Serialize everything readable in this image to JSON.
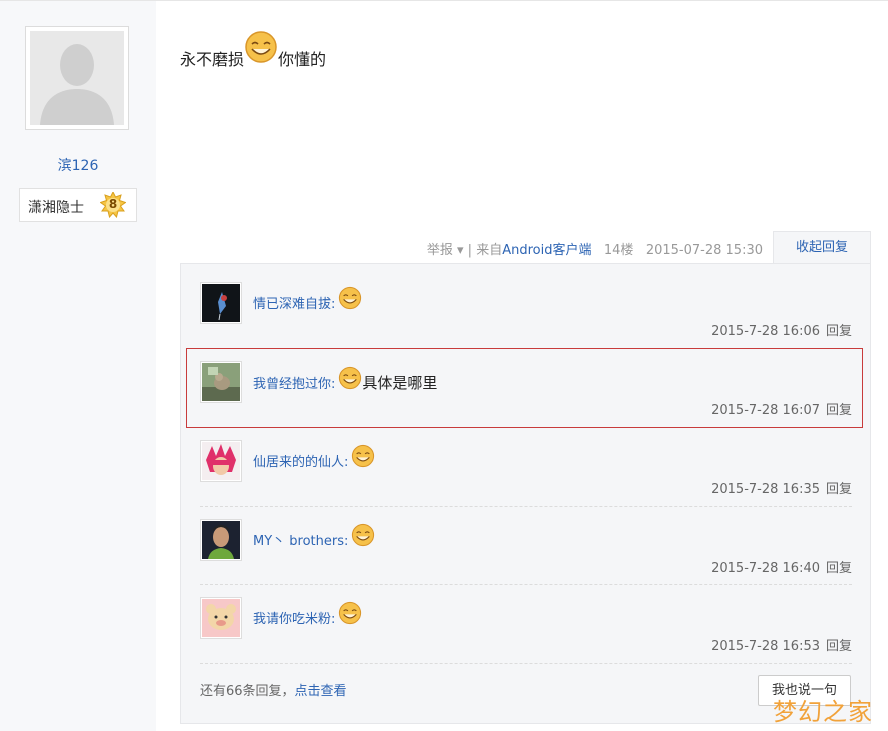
{
  "sidebar": {
    "username": "滨126",
    "rank_title": "潇湘隐士",
    "rank_level": "8"
  },
  "post": {
    "text_before": "永不磨损",
    "text_after": "你懂的",
    "report_label": "举报",
    "separator": "|",
    "source_prefix": "来自",
    "source_client": "Android客户端",
    "floor": "14楼",
    "timestamp": "2015-07-28 15:30"
  },
  "replies_panel": {
    "collapse_label": "收起回复",
    "items": [
      {
        "name": "情已深难自拔:",
        "content": "",
        "time": "2015-7-28 16:06",
        "reply_label": "回复"
      },
      {
        "name": "我曾经抱过你:",
        "content": "具体是哪里",
        "time": "2015-7-28 16:07",
        "reply_label": "回复"
      },
      {
        "name": "仙居来的的仙人:",
        "content": "",
        "time": "2015-7-28 16:35",
        "reply_label": "回复"
      },
      {
        "name": "MY丶 brothers:",
        "content": "",
        "time": "2015-7-28 16:40",
        "reply_label": "回复"
      },
      {
        "name": "我请你吃米粉:",
        "content": "",
        "time": "2015-7-28 16:53",
        "reply_label": "回复"
      }
    ],
    "more_prefix": "还有66条回复，",
    "more_link": "点击查看",
    "say_button": "我也说一句"
  },
  "watermark": "梦幻之家",
  "colors": {
    "link": "#2d64b3",
    "highlight_border": "#c83b3b",
    "panel_bg": "#f5f6f8",
    "sidebar_bg": "#f7f8fa",
    "watermark": "#f1a23a"
  }
}
